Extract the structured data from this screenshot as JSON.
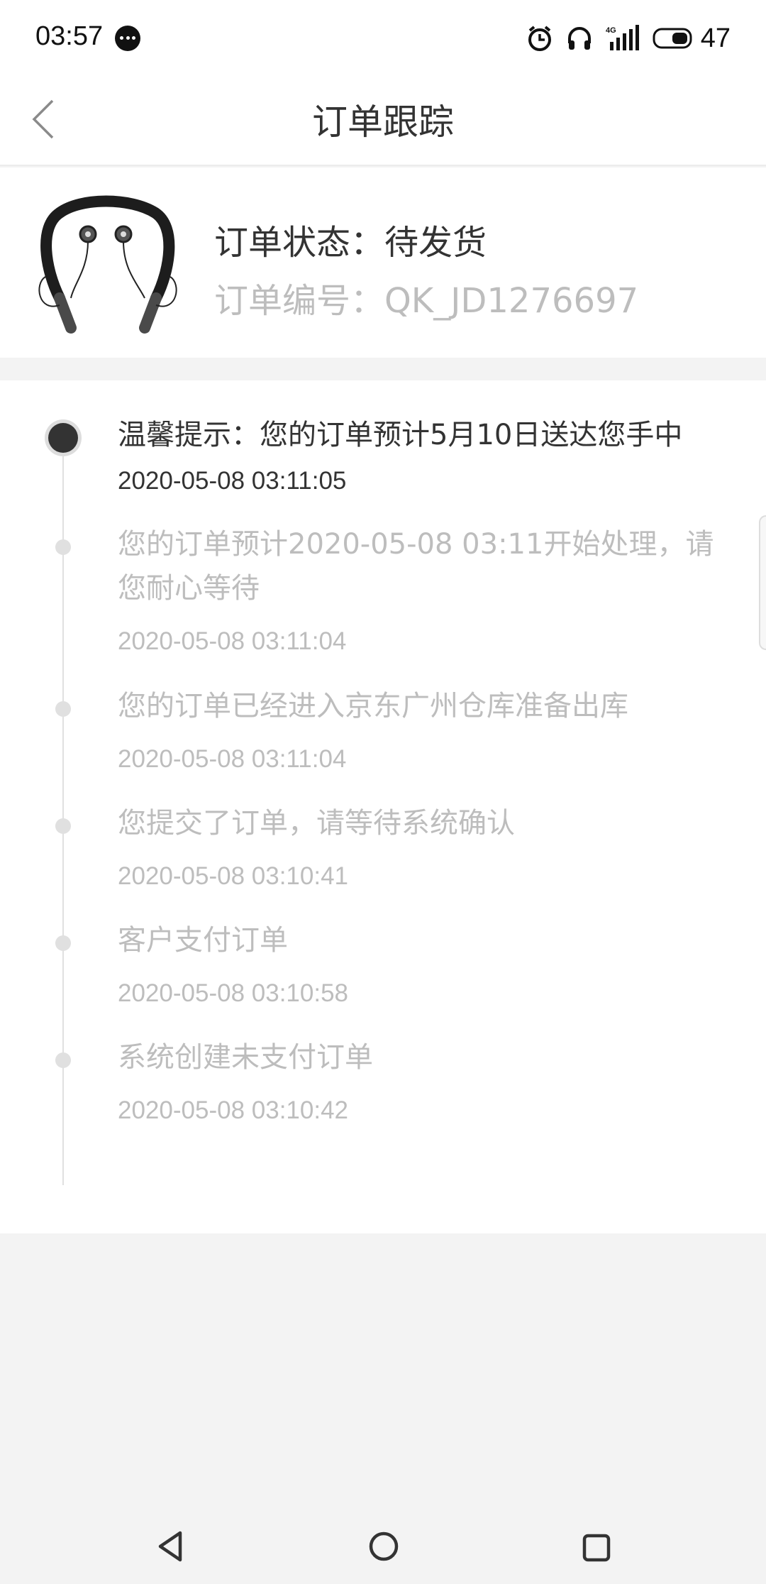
{
  "status_bar": {
    "time": "03:57",
    "battery_level": "47",
    "network": "4G"
  },
  "header": {
    "title": "订单跟踪"
  },
  "order": {
    "status_text": "订单状态：待发货",
    "number_text": "订单编号：QK_JD1276697"
  },
  "timeline": {
    "items": [
      {
        "text": "温馨提示：您的订单预计5月10日送达您手中",
        "time": "2020-05-08 03:11:05"
      },
      {
        "text": "您的订单预计2020-05-08 03:11开始处理，请您耐心等待",
        "time": "2020-05-08 03:11:04"
      },
      {
        "text": "您的订单已经进入京东广州仓库准备出库",
        "time": "2020-05-08 03:11:04"
      },
      {
        "text": "您提交了订单，请等待系统确认",
        "time": "2020-05-08 03:10:41"
      },
      {
        "text": "客户支付订单",
        "time": "2020-05-08 03:10:58"
      },
      {
        "text": "系统创建未支付订单",
        "time": "2020-05-08 03:10:42"
      }
    ]
  },
  "colors": {
    "active_text": "#333333",
    "inactive_text": "#bdbdbd",
    "page_bg": "#f3f3f3"
  }
}
